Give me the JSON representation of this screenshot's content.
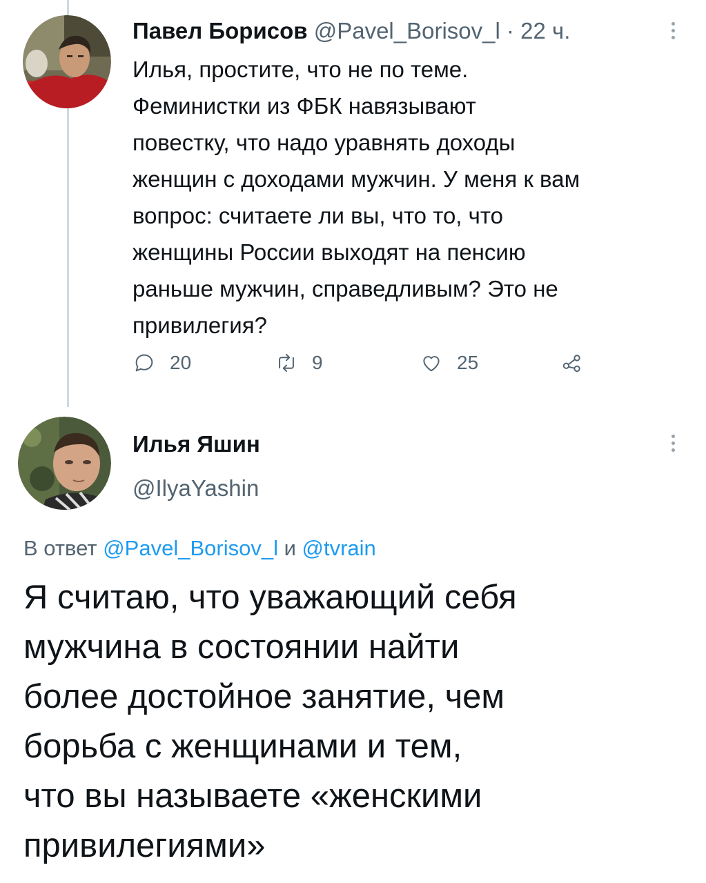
{
  "tweet1": {
    "author_name": "Павел Борисов",
    "author_handle": "@Pavel_Borisov_l",
    "time": "· 22 ч.",
    "text": "Илья, простите, что не по теме.\nФеминистки из ФБК навязывают\nповестку, что надо уравнять доходы\nженщин с доходами мужчин. У меня к вам\nвопрос: считаете ли вы, что то, что\nженщины России выходят на пенсию\nраньше мужчин, справедливым? Это не\nпривилегия?",
    "replies": "20",
    "retweets": "9",
    "likes": "25"
  },
  "tweet2": {
    "author_name": "Илья Яшин",
    "author_handle": "@IlyaYashin",
    "reply_prefix": "В ответ ",
    "reply_user1": "@Pavel_Borisov_l",
    "reply_and": " и ",
    "reply_user2": "@tvrain",
    "text": "Я считаю, что уважающий себя\nмужчина в состоянии найти\nболее достойное занятие, чем\nборьба с женщинами и тем,\nчто вы называете «женскими\nпривилегиями»"
  },
  "colors": {
    "text": "#0f1419",
    "secondary": "#536471",
    "link": "#1d9bf0",
    "thread_line": "#cfd9de"
  },
  "icons": [
    "reply-icon",
    "retweet-icon",
    "like-icon",
    "share-icon",
    "more-icon"
  ]
}
